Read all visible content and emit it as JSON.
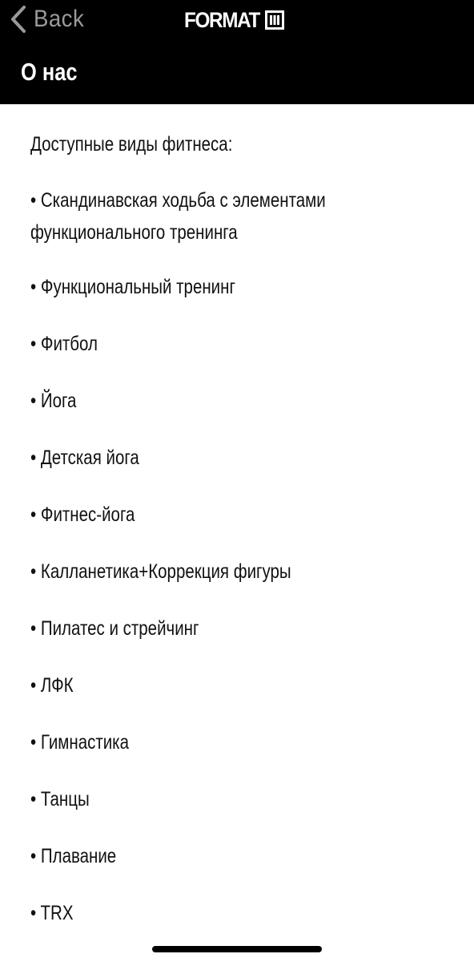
{
  "nav": {
    "back_label": "Back",
    "logo_text": "FORMAT",
    "logo_icon": "format-logo-mark-icon"
  },
  "header": {
    "title": "О нас"
  },
  "content": {
    "intro": "Доступные виды фитнеса:",
    "items": [
      [
        "• Скандинавская ходьба с элементами",
        "функционального тренинга"
      ],
      [
        "• Функциональный тренинг"
      ],
      [
        "• Фитбол"
      ],
      [
        "• Йога"
      ],
      [
        "• Детская йога"
      ],
      [
        "• Фитнес-йога"
      ],
      [
        "• Калланетика+Коррекция фигуры"
      ],
      [
        "• Пилатес и стрейчинг"
      ],
      [
        "• ЛФК"
      ],
      [
        "• Гимнастика"
      ],
      [
        "• Танцы"
      ],
      [
        "• Плавание"
      ],
      [
        "• TRX"
      ]
    ]
  },
  "colors": {
    "header_background": "#000000",
    "header_text": "#ffffff",
    "back_text": "#9a9a9a",
    "body_background": "#ffffff",
    "body_text": "#111111"
  }
}
